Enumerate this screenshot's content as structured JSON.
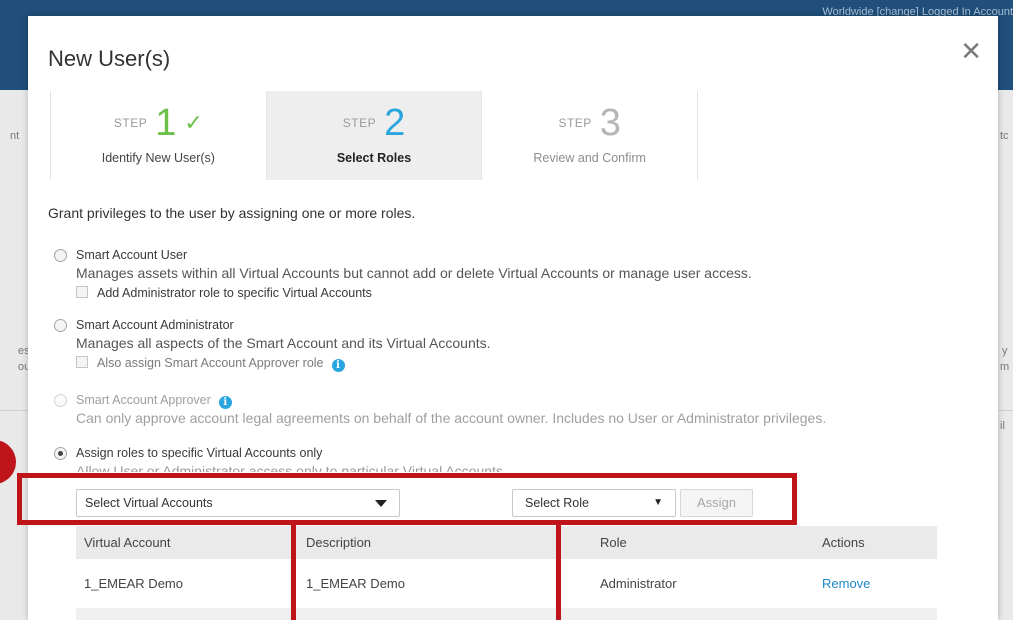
{
  "background": {
    "top_links": "Worldwide [change]    Logged In    Account",
    "fragments": [
      "nt",
      "tc",
      "es",
      "ou",
      "y",
      "m",
      "il"
    ]
  },
  "modal": {
    "title": "New User(s)",
    "close_glyph": "✕",
    "steps": [
      {
        "word": "STEP",
        "number": "1",
        "label": "Identify New User(s)",
        "state": "done",
        "check": "✓"
      },
      {
        "word": "STEP",
        "number": "2",
        "label": "Select Roles",
        "state": "active"
      },
      {
        "word": "STEP",
        "number": "3",
        "label": "Review and Confirm",
        "state": "todo"
      }
    ],
    "intro": "Grant privileges to the user by assigning one or more roles.",
    "options": [
      {
        "title": "Smart Account User",
        "description": "Manages assets within all Virtual Accounts but cannot add or delete Virtual Accounts or manage user access.",
        "sub_option": "Add Administrator role to specific Virtual Accounts",
        "checked": false
      },
      {
        "title": "Smart Account Administrator",
        "description": "Manages all aspects of the Smart Account and its Virtual Accounts.",
        "sub_option": "Also assign Smart Account Approver role",
        "checked": false
      },
      {
        "title": "Smart Account Approver",
        "description": "Can only approve account legal agreements on behalf of the account owner. Includes no User or Administrator privileges.",
        "disabled": true,
        "checked": false
      },
      {
        "title": "Assign roles to specific Virtual Accounts only",
        "description": "Allow User or Administrator access only to particular Virtual Accounts.",
        "checked": true
      }
    ],
    "assign_row": {
      "virtual_accounts_select": "Select Virtual Accounts",
      "role_select": "Select Role",
      "assign_button": "Assign"
    },
    "table": {
      "headers": [
        "Virtual Account",
        "Description",
        "Role",
        "Actions"
      ],
      "rows": [
        {
          "virtual_account": "1_EMEAR Demo",
          "description": "1_EMEAR Demo",
          "role": "Administrator",
          "action": "Remove"
        }
      ]
    }
  },
  "colors": {
    "accent_blue": "#2aa6de",
    "step_done_green": "#6cc04a",
    "annotation_red": "#c0141b",
    "link_blue": "#1e88c7"
  }
}
